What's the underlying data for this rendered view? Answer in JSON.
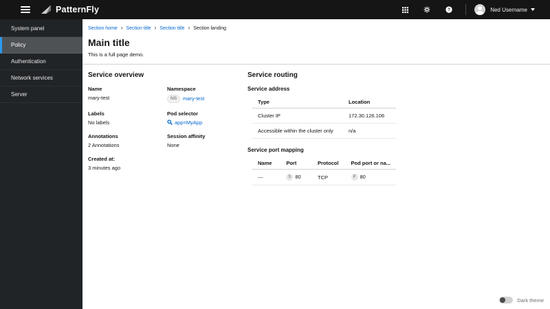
{
  "colors": {
    "masthead_bg": "#151515",
    "sidebar_bg": "#212427",
    "sidebar_selected_bg": "#4f5255",
    "sidebar_selected_border": "#2b9af3",
    "link_blue": "#0066cc",
    "muted_text": "#6a6e73",
    "table_border": "#d2d2d2"
  },
  "masthead": {
    "brand": "PatternFly",
    "user": {
      "name": "Ned Username"
    }
  },
  "sidebar": {
    "items": [
      {
        "label": "System panel"
      },
      {
        "label": "Policy"
      },
      {
        "label": "Authentication"
      },
      {
        "label": "Network services"
      },
      {
        "label": "Server"
      }
    ]
  },
  "breadcrumb": {
    "separator": "›",
    "items": [
      {
        "label": "Section home"
      },
      {
        "label": "Section title"
      },
      {
        "label": "Section title"
      },
      {
        "label": "Section landing"
      }
    ]
  },
  "page": {
    "title": "Main title",
    "subtitle": "This is a full page demo."
  },
  "service_overview": {
    "title": "Service overview",
    "fields": [
      {
        "label": "Name",
        "value": "mary-test"
      },
      {
        "label": "Namespace",
        "badge": "NS",
        "value": "mary-test"
      },
      {
        "label": "Labels",
        "value": "No labels"
      },
      {
        "label": "Pod selector",
        "value": "app=MyApp"
      },
      {
        "label": "Annotations",
        "value": "2 Annotations"
      },
      {
        "label": "Session affinity",
        "value": "None"
      },
      {
        "label": "Created at:",
        "value": "3 minutes ago"
      }
    ]
  },
  "service_routing": {
    "title": "Service routing",
    "address": {
      "title": "Service address",
      "columns": [
        "Type",
        "Location"
      ],
      "rows": [
        [
          "Cluster IP",
          "172.30.126.106"
        ],
        [
          "Accessible within the cluster only",
          "n/a"
        ]
      ]
    },
    "port_mapping": {
      "title": "Service port mapping",
      "columns": [
        "Name",
        "Port",
        "Protocol",
        "Pod port or na..."
      ],
      "row": {
        "name": "---",
        "port_badge": "S",
        "port": "80",
        "protocol": "TCP",
        "pod_badge": "P",
        "pod_port": "80"
      }
    }
  },
  "footer": {
    "dark_theme_label": "Dark theme"
  }
}
